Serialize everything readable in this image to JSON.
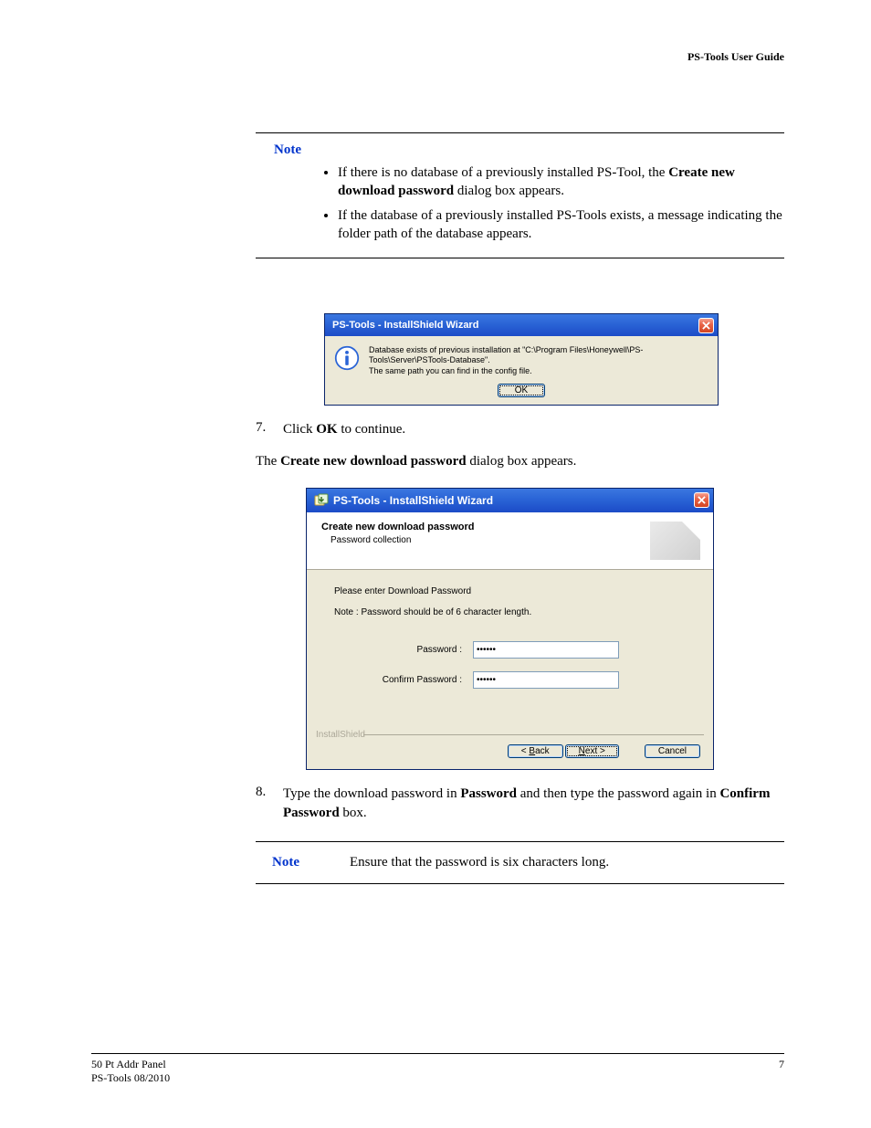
{
  "header": {
    "title": "PS-Tools User Guide"
  },
  "note1": {
    "label": "Note",
    "bullet1_pre": "If there is no database of a previously installed PS-Tool, the ",
    "bullet1_bold": "Create new download password",
    "bullet1_post": " dialog box appears.",
    "bullet2": "If the database of a previously installed PS-Tools exists, a message indicating the folder path of the database appears."
  },
  "msgbox": {
    "title": "PS-Tools - InstallShield Wizard",
    "text_line1": "Database exists of previous installation at \"C:\\Program Files\\Honeywell\\PS-Tools\\Server\\PSTools-Database\".",
    "text_line2": "The same path you can find in the config file.",
    "ok": "OK"
  },
  "step7": {
    "num": "7.",
    "pre": "Click ",
    "bold": "OK",
    "post": " to continue."
  },
  "para1": {
    "pre": "The ",
    "bold": "Create new download password",
    "post": " dialog box appears."
  },
  "wizard": {
    "title": "PS-Tools - InstallShield Wizard",
    "header_title": "Create new download password",
    "header_sub": "Password collection",
    "prompt": "Please enter Download Password",
    "note": "Note : Password should be of 6 character length.",
    "password_label": "Password :",
    "confirm_label": "Confirm Password :",
    "password_value": "******",
    "confirm_value": "******",
    "brand": "InstallShield",
    "back_pre": "< ",
    "back_u": "B",
    "back_post": "ack",
    "next_u": "N",
    "next_post": "ext >",
    "cancel": "Cancel"
  },
  "step8": {
    "num": "8.",
    "pre": "Type the download password in ",
    "bold1": "Password",
    "mid": " and then type the password again in ",
    "bold2": "Confirm Password",
    "post": " box."
  },
  "note2": {
    "label": "Note",
    "text": "Ensure that the password is six characters long."
  },
  "footer": {
    "line1": "50 Pt Addr Panel",
    "line2": "PS-Tools  08/2010",
    "pagenum": "7"
  }
}
